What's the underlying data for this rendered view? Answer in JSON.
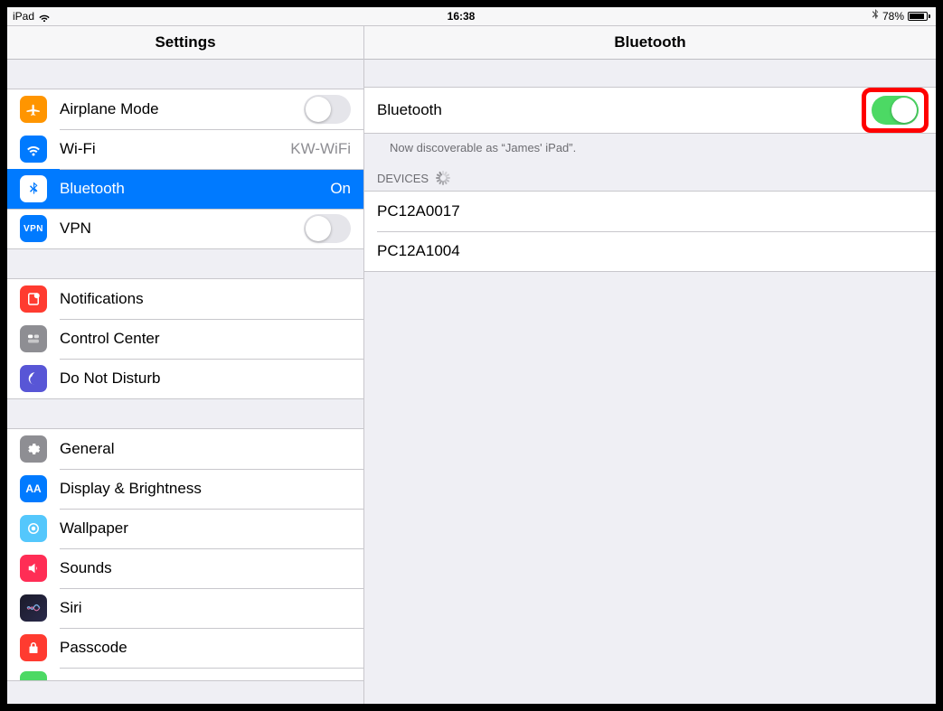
{
  "status": {
    "device": "iPad",
    "time": "16:38",
    "battery_pct": "78%"
  },
  "sidebar": {
    "title": "Settings",
    "groups": [
      {
        "cells": [
          {
            "key": "airplane",
            "label": "Airplane Mode",
            "toggle": false
          },
          {
            "key": "wifi",
            "label": "Wi-Fi",
            "accessory": "KW-WiFi"
          },
          {
            "key": "bluetooth",
            "label": "Bluetooth",
            "accessory": "On",
            "selected": true
          },
          {
            "key": "vpn",
            "label": "VPN",
            "toggle": false
          }
        ]
      },
      {
        "cells": [
          {
            "key": "notifications",
            "label": "Notifications"
          },
          {
            "key": "controlcenter",
            "label": "Control Center"
          },
          {
            "key": "dnd",
            "label": "Do Not Disturb"
          }
        ]
      },
      {
        "cells": [
          {
            "key": "general",
            "label": "General"
          },
          {
            "key": "display",
            "label": "Display & Brightness"
          },
          {
            "key": "wallpaper",
            "label": "Wallpaper"
          },
          {
            "key": "sounds",
            "label": "Sounds"
          },
          {
            "key": "siri",
            "label": "Siri"
          },
          {
            "key": "passcode",
            "label": "Passcode"
          }
        ]
      }
    ]
  },
  "detail": {
    "title": "Bluetooth",
    "bluetooth_label": "Bluetooth",
    "bluetooth_on": true,
    "discoverable_text": "Now discoverable as “James' iPad”.",
    "devices_header": "DEVICES",
    "devices": [
      {
        "name": "PC12A0017"
      },
      {
        "name": "PC12A1004"
      }
    ]
  }
}
